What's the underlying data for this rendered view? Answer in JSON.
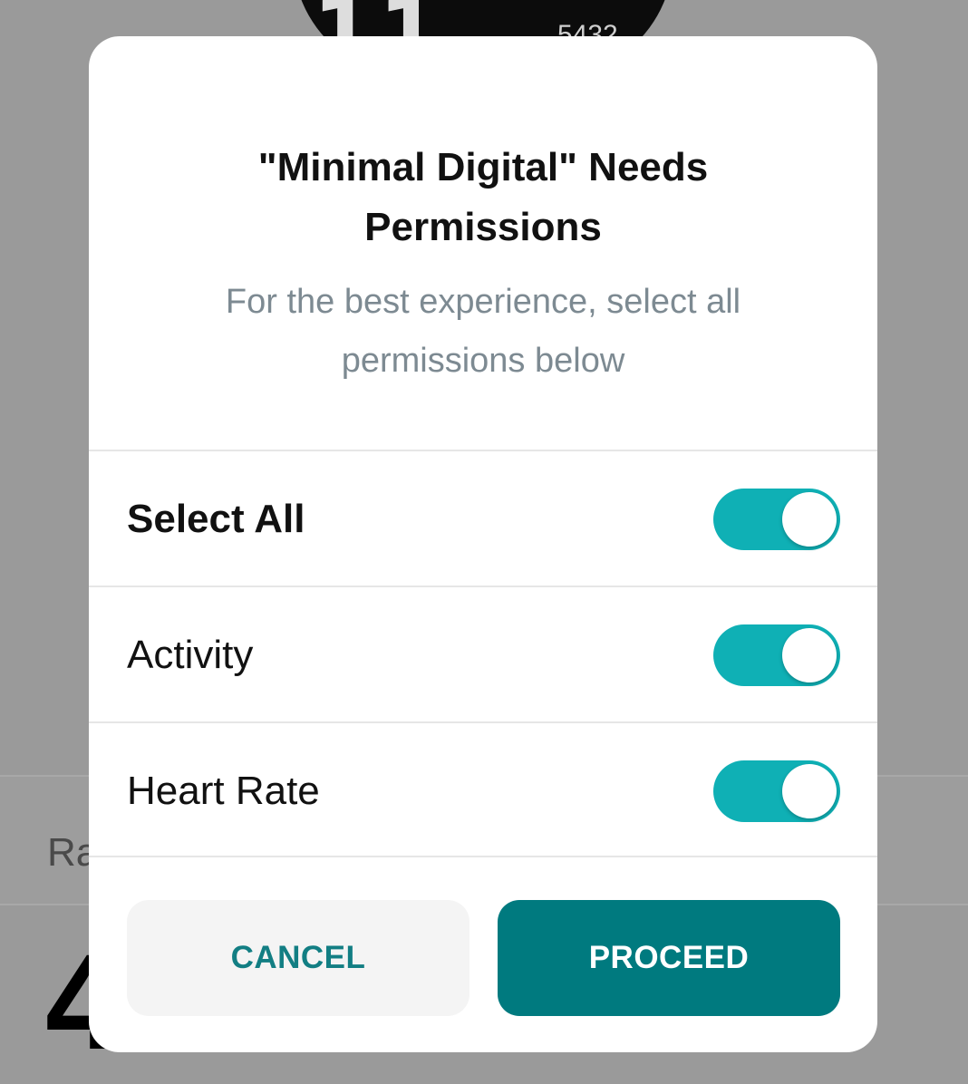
{
  "background": {
    "watch_time": "11",
    "watch_steps": "5432",
    "row_label": "Ra",
    "big_number": "4"
  },
  "dialog": {
    "title": "\"Minimal Digital\" Needs Permissions",
    "subtitle": "For the best experience, select all permissions below",
    "permissions": [
      {
        "label": "Select All",
        "enabled": true,
        "bold": true
      },
      {
        "label": "Activity",
        "enabled": true,
        "bold": false
      },
      {
        "label": "Heart Rate",
        "enabled": true,
        "bold": false
      }
    ],
    "cancel_label": "CANCEL",
    "proceed_label": "PROCEED"
  },
  "colors": {
    "accent": "#0fb0b5",
    "primary_button": "#007a7f",
    "cancel_text": "#127e83",
    "subtitle_text": "#7d8a92",
    "overlay": "#9a9a9a"
  }
}
